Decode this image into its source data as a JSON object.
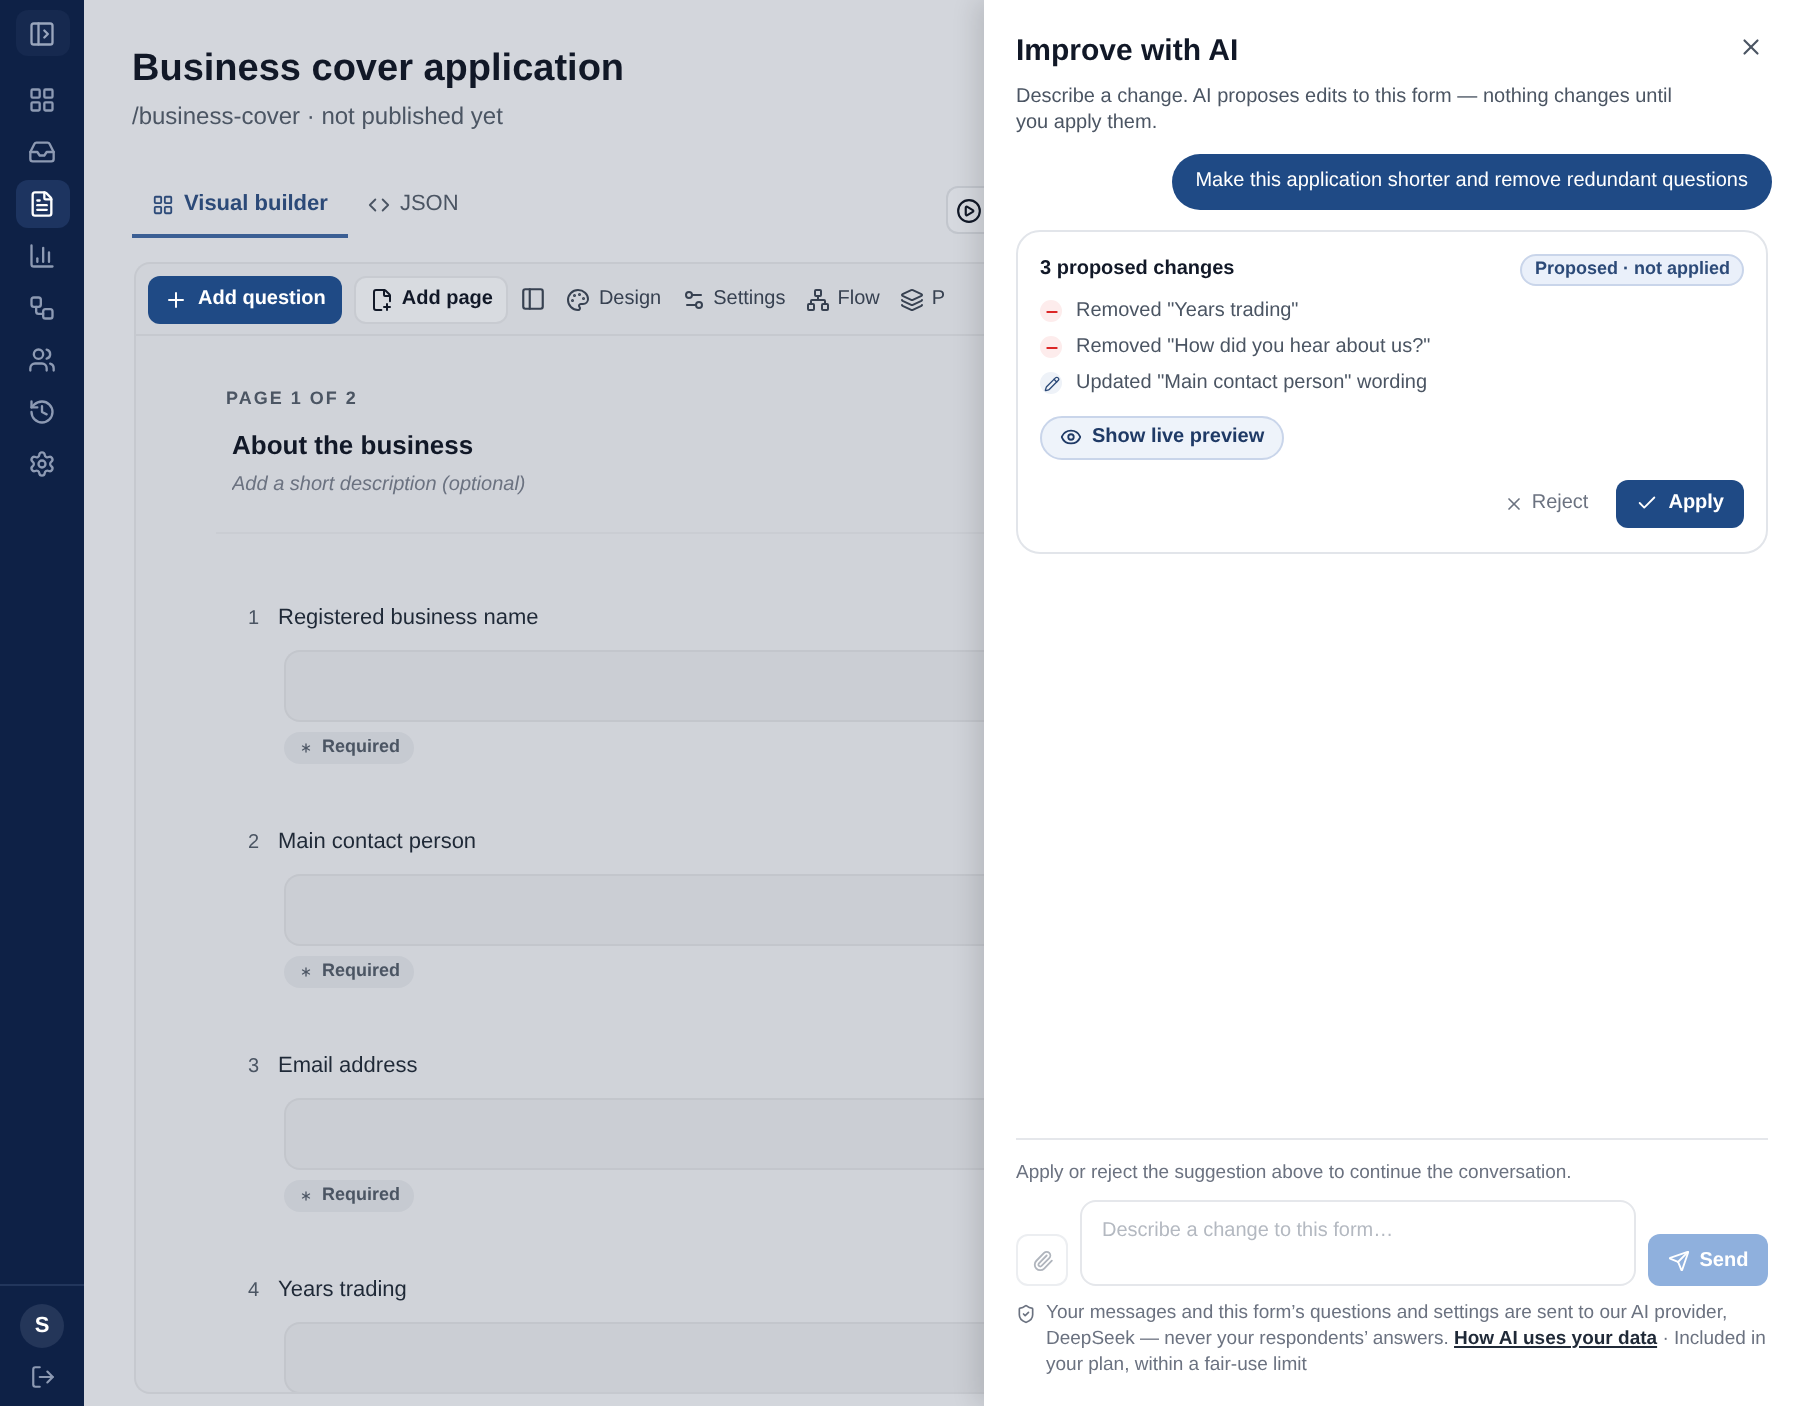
{
  "sidebar": {
    "items": [
      {
        "selected": false
      },
      {
        "selected": false
      },
      {
        "selected": true
      },
      {
        "selected": false
      },
      {
        "selected": false
      },
      {
        "selected": false
      },
      {
        "selected": false
      },
      {
        "selected": false
      }
    ],
    "avatar": "S"
  },
  "page": {
    "title": "Business cover application",
    "subtitle": "/business-cover · not published yet"
  },
  "tabs": [
    {
      "label": "Visual builder",
      "selected": true
    },
    {
      "label": "JSON",
      "selected": false
    }
  ],
  "toolbar": {
    "primary": "Add question",
    "secondary": "Add page",
    "items": [
      "Design",
      "Settings",
      "Flow",
      "P"
    ]
  },
  "canvas": {
    "page_label": "PAGE 1 OF 2",
    "heading": "About the business",
    "description_placeholder": "Add a short description (optional)",
    "questions": [
      {
        "number": "1",
        "label": "Registered business name",
        "badge": "Required"
      },
      {
        "number": "2",
        "label": "Main contact person",
        "badge": "Required"
      },
      {
        "number": "3",
        "label": "Email address",
        "badge": "Required"
      },
      {
        "number": "4",
        "label": "Years trading"
      }
    ]
  },
  "panel": {
    "title": "Improve with AI",
    "description": "Describe a change. AI proposes edits to this form — nothing changes until you apply them.",
    "user_message": "Make this application shorter and remove redundant questions",
    "proposal": {
      "title": "3 proposed changes",
      "status": "Proposed · not applied",
      "changes": [
        {
          "kind": "removed",
          "text": "Removed \"Years trading\""
        },
        {
          "kind": "removed",
          "text": "Removed \"How did you hear about us?\""
        },
        {
          "kind": "updated",
          "text": "Updated \"Main contact person\" wording"
        }
      ],
      "preview": "Show live preview",
      "reject": "Reject",
      "apply": "Apply"
    },
    "hint": "Apply or reject the suggestion above to continue the conversation.",
    "composer": {
      "placeholder": "Describe a change to this form…",
      "send": "Send",
      "send_disabled": true
    },
    "notice": {
      "text": "Your messages and this form’s questions and settings are sent to our AI provider, DeepSeek — never your respondents’ answers.",
      "link": "How AI uses your data",
      "after": "· Included in your plan, within a fair-use limit"
    }
  }
}
